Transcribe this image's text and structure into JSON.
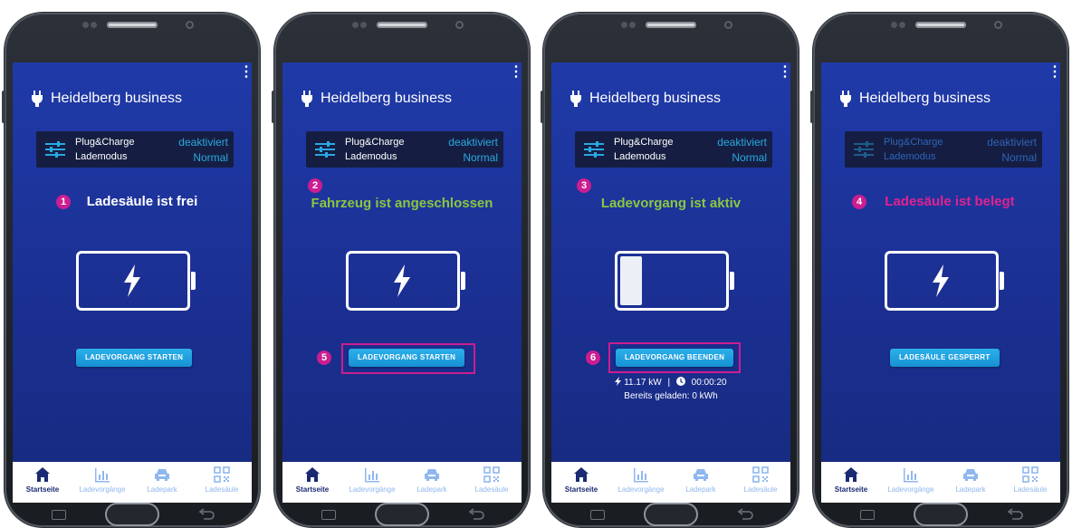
{
  "colors": {
    "screen_bg": "#1c3399",
    "accent_magenta": "#cc1d91",
    "green_status": "#8cc63f",
    "button_blue": "#1ea1e0",
    "settings_value": "#29a9e1",
    "tab_active": "#1a2a73",
    "tab_inactive": "#8fb7ef"
  },
  "phones": [
    {
      "menu": "⋮",
      "station_name": "Heidelberg business",
      "plug_charge_label": "Plug&Charge",
      "plug_charge_value": "deaktiviert",
      "mode_label": "Lademodus",
      "mode_value": "Normal",
      "badge": "1",
      "status_text": "Ladesäule ist frei",
      "status_color": "#ffffff",
      "battery_fill_fraction": 0,
      "battery_icon": "lightning-bolt-icon",
      "action_badge": "",
      "action_button": "LADEVORGANG STARTEN",
      "tabs": [
        "Startseite",
        "Ladevorgänge",
        "Ladepark",
        "Ladesäule"
      ]
    },
    {
      "menu": "⋮",
      "station_name": "Heidelberg business",
      "plug_charge_label": "Plug&Charge",
      "plug_charge_value": "deaktiviert",
      "mode_label": "Lademodus",
      "mode_value": "Normal",
      "badge": "2",
      "status_text": "Fahrzeug ist angeschlossen",
      "status_color": "#8cc63f",
      "battery_fill_fraction": 0,
      "battery_icon": "lightning-bolt-icon",
      "action_badge": "5",
      "action_button": "LADEVORGANG STARTEN",
      "tabs": [
        "Startseite",
        "Ladevorgänge",
        "Ladepark",
        "Ladesäule"
      ]
    },
    {
      "menu": "⋮",
      "station_name": "Heidelberg business",
      "plug_charge_label": "Plug&Charge",
      "plug_charge_value": "deaktiviert",
      "mode_label": "Lademodus",
      "mode_value": "Normal",
      "badge": "3",
      "status_text": "Ladevorgang ist aktiv",
      "status_color": "#8cc63f",
      "battery_fill_fraction": 0.2,
      "action_badge": "6",
      "action_button": "LADEVORGANG BEENDEN",
      "power": "11.17 kW",
      "separator": "|",
      "duration": "00:00:20",
      "charged": "Bereits geladen: 0 kWh",
      "tabs": [
        "Startseite",
        "Ladevorgänge",
        "Ladepark",
        "Ladesäule"
      ]
    },
    {
      "menu": "⋮",
      "station_name": "Heidelberg business",
      "plug_charge_label": "Plug&Charge",
      "plug_charge_value": "deaktiviert",
      "mode_label": "Lademodus",
      "mode_value": "Normal",
      "badge": "4",
      "status_text": "Ladesäule ist belegt",
      "status_color": "#e0228f",
      "battery_fill_fraction": 0,
      "battery_icon": "lightning-bolt-icon",
      "action_badge": "",
      "action_button": "LADESÄULE GESPERRT",
      "tabs": [
        "Startseite",
        "Ladevorgänge",
        "Ladepark",
        "Ladesäule"
      ]
    }
  ]
}
